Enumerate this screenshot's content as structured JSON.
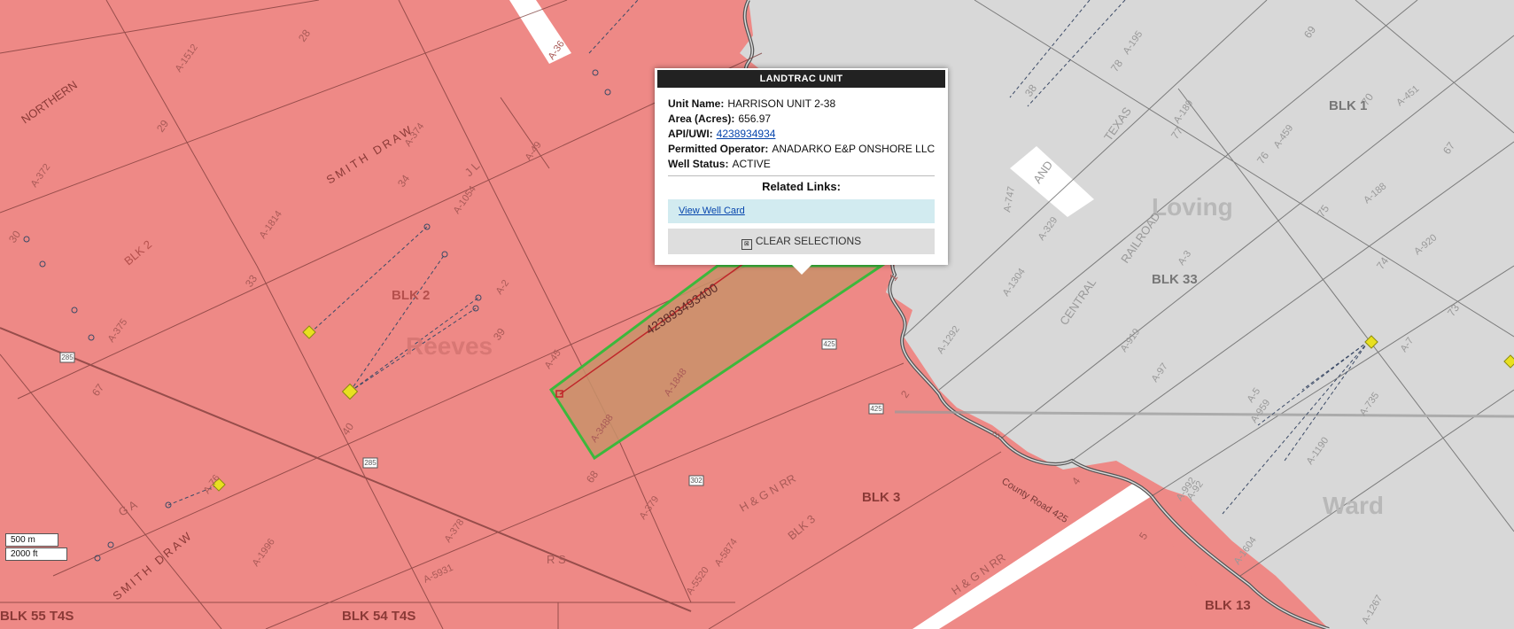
{
  "popup": {
    "title": "LANDTRAC UNIT",
    "fields": {
      "unit_name_label": "Unit Name:",
      "unit_name_value": "HARRISON UNIT 2-38",
      "area_label": "Area (Acres):",
      "area_value": "656.97",
      "api_label": "API/UWI:",
      "api_value": "4238934934",
      "operator_label": "Permitted Operator:",
      "operator_value": "ANADARKO E&P ONSHORE LLC",
      "status_label": "Well Status:",
      "status_value": "ACTIVE"
    },
    "related_links_heading": "Related Links:",
    "view_well_card": "View Well Card",
    "clear_selections": "CLEAR SELECTIONS"
  },
  "scale": {
    "metric": "500 m",
    "imperial": "2000 ft"
  },
  "map_labels": {
    "county_reeves": "Reeves",
    "county_loving": "Loving",
    "county_ward": "Ward",
    "blk2": "BLK 2",
    "blk2_small": "BLK 2",
    "blk3": "BLK 3",
    "blk3_lower": "BLK 3",
    "blk33": "BLK 33",
    "blk13": "BLK 13",
    "blk1": "BLK 1",
    "blk55": "BLK 55 T4S",
    "blk54": "BLK 54 T4S",
    "northern": "NORTHERN",
    "smith_draw": "SMITH DRAW",
    "smith_draw_lower": "SMITH DRAW",
    "texas": "TEXAS",
    "central": "CENTRAL",
    "railroad": "RAILROAD",
    "and": "AND",
    "hgnrr": "H & G N RR",
    "hgnrr_lower": "H & G N RR",
    "county_road": "County Road 425",
    "well_api_label": "423893493400",
    "jl": "J L",
    "rs": "R S",
    "ga": "G A",
    "abstracts": [
      "A-1512",
      "A-372",
      "A-374",
      "A-49",
      "A-1054",
      "A-1814",
      "A-375",
      "A-2",
      "A-45",
      "A-1848",
      "A-3488",
      "A-379",
      "A-378",
      "A-5931",
      "A-5874",
      "A-5520",
      "A-1996",
      "A-76",
      "A-36",
      "A-195",
      "A-189",
      "A-459",
      "A-188",
      "A-451",
      "A-1304",
      "A-329",
      "A-1292",
      "A-919",
      "A-97",
      "A-92",
      "A-5",
      "A-959",
      "A-1190",
      "A-735",
      "A-7",
      "A-920",
      "A-992",
      "A-1267",
      "A-1604",
      "A-3",
      "A-747"
    ],
    "sections": [
      "28",
      "29",
      "34",
      "33",
      "39",
      "40",
      "67",
      "68",
      "30",
      "78",
      "77",
      "76",
      "75",
      "74",
      "73",
      "70",
      "69",
      "67",
      "1",
      "2",
      "3",
      "4",
      "5",
      "38"
    ],
    "highways": [
      "285",
      "285",
      "425",
      "425",
      "302"
    ]
  },
  "colors": {
    "reeves_fill": "#ee8986",
    "gray_fill": "#d8d8d8",
    "unit_fill": "#c9926a",
    "unit_stroke": "#3cb83c",
    "well_marker": "#e8e020",
    "river": "#555555"
  }
}
